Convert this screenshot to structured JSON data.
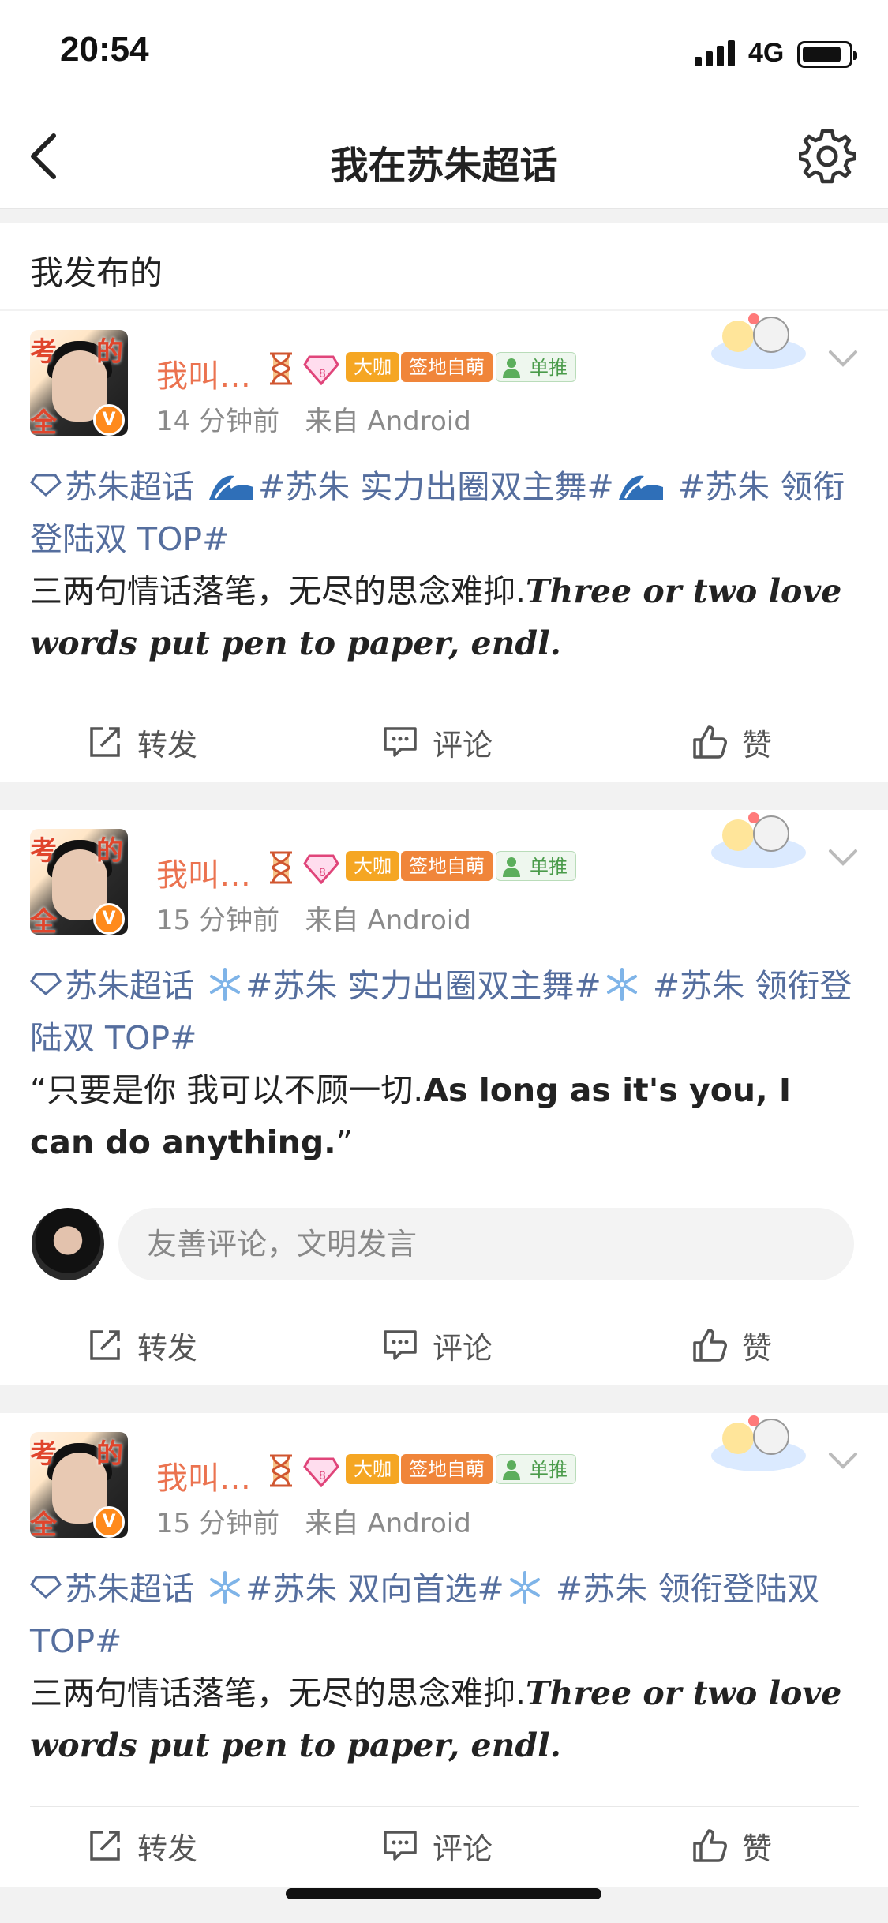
{
  "status": {
    "time": "20:54",
    "network": "4G"
  },
  "nav": {
    "title": "我在苏朱超话"
  },
  "section": {
    "title": "我发布的"
  },
  "posts": [
    {
      "username": "我叫…",
      "tags": [
        "大咖",
        "签地自萌",
        "单推"
      ],
      "time": "14 分钟前",
      "source": "来自 Android",
      "topic": "苏朱超话",
      "hashtag1": "#苏朱 实力出圈双主舞#",
      "hashtag2": "#苏朱 领衔登陆双 TOP#",
      "text_cn": "三两句情话落笔，无尽的思念难抑.",
      "text_en": "Three or two love words put pen to paper, endl."
    },
    {
      "username": "我叫…",
      "tags": [
        "大咖",
        "签地自萌",
        "单推"
      ],
      "time": "15 分钟前",
      "source": "来自 Android",
      "topic": "苏朱超话",
      "hashtag1": "#苏朱 实力出圈双主舞#",
      "hashtag2": "#苏朱 领衔登陆双 TOP#",
      "text_cn": "“只要是你 我可以不顾一切.",
      "text_en": "As long as it's you, I can do anything.",
      "text_end": "”",
      "comment_placeholder": "友善评论，文明发言"
    },
    {
      "username": "我叫…",
      "tags": [
        "大咖",
        "签地自萌",
        "单推"
      ],
      "time": "15 分钟前",
      "source": "来自 Android",
      "topic": "苏朱超话",
      "hashtag1": "#苏朱 双向首选#",
      "hashtag2": "#苏朱 领衔登陆双 TOP#",
      "text_cn": "三两句情话落笔，无尽的思念难抑.",
      "text_en": "Three or two love words put pen to paper, endl."
    }
  ],
  "actions": {
    "forward": "转发",
    "comment": "评论",
    "like": "赞"
  },
  "avatar_chars": [
    "考",
    "的",
    "全"
  ],
  "colors": {
    "username": "#eb7350",
    "topic": "#556e9e",
    "tag_dk": "#f5a623",
    "tag_sd": "#f0853a"
  }
}
